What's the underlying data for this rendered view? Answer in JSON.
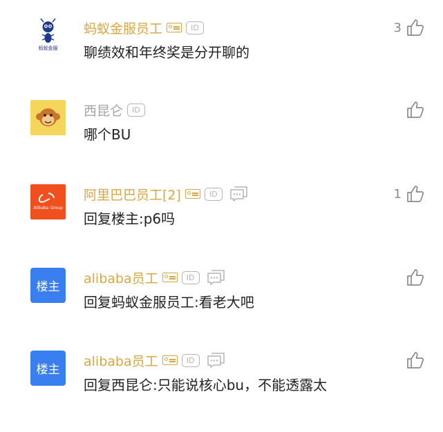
{
  "id_badge": "ID",
  "comments": [
    {
      "name": "蚂蚁金服员工",
      "text": "聊绩效和年终奖是分开聊的",
      "likes": "3",
      "avatar_icon": "ant-financial-logo-icon",
      "avatar_label": "蚂蚁金服"
    },
    {
      "name": "西昆仑",
      "text": "哪个BU",
      "likes": "",
      "avatar_icon": "monkey-avatar-icon"
    },
    {
      "name": "阿里巴巴员工[2]",
      "text": "回复楼主:p6吗",
      "likes": "1",
      "avatar_icon": "alibaba-logo-icon",
      "avatar_label": "Alibaba Group"
    },
    {
      "name": "alibaba员工",
      "text": "回复蚂蚁金服员工:看老大吧",
      "likes": "",
      "avatar_label": "楼主"
    },
    {
      "name": "alibaba员工",
      "text": "回复西昆仑:只能说核心bu，不能透露太",
      "likes": "",
      "avatar_label": "楼主"
    }
  ],
  "colors": {
    "gold_name": "#d9a740",
    "grey_name": "#a5a5a5",
    "host_badge": "#3a7ff0",
    "alibaba_orange": "#f1501e"
  }
}
